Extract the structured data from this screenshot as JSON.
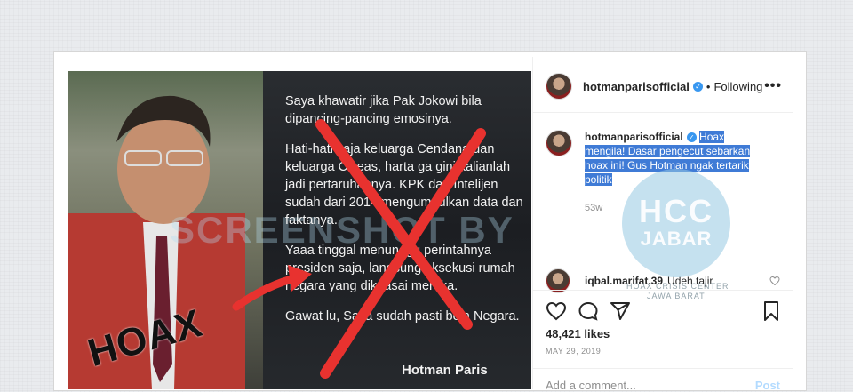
{
  "post": {
    "image_text": {
      "paragraphs": [
        "Saya khawatir jika Pak Jokowi bila dipancing-pancing emosinya.",
        "Hati-hati saja keluarga Cendana dan keluarga Cikeas, harta ga gini kalianlah jadi pertaruhannya. KPK dan Intelijen sudah dari 2014 mengumpulkan data dan faktanya.",
        "Yaaa tinggal menunggu perintahnya presiden saja, langsung eksekusi rumah negara yang dikuasai mereka.",
        "Gawat lu, Saya sudah pasti bela Negara."
      ],
      "signature": "Hotman Paris",
      "stamp": "HOAX",
      "watermark": "SCREENSHOT BY"
    },
    "header": {
      "username": "hotmanparisofficial",
      "separator": "•",
      "following": "Following",
      "more": "•••"
    },
    "caption": {
      "username": "hotmanparisofficial",
      "text": "Hoax mengila! Dasar pengecut sebarkan hoax ini! Gus Hotman ngak tertarik politik",
      "age": "53w"
    },
    "comment": {
      "username": "iqbal.marifat.39",
      "text": "Udeh tajir"
    },
    "likes": "48,421 likes",
    "date": "MAY 29, 2019",
    "add_comment_placeholder": "Add a comment...",
    "post_label": "Post",
    "logo": {
      "main": "HCC",
      "sub": "JABAR",
      "caption_line1": "HOAX CRISIS CENTER",
      "caption_line2": "JAWA BARAT"
    }
  },
  "colors": {
    "accent": "#3897f0",
    "highlight": "#3f7bd6",
    "cross": "#e8322f"
  },
  "icons": [
    "heart-icon",
    "comment-icon",
    "share-icon",
    "bookmark-icon",
    "more-icon",
    "verified-icon",
    "like-comment-icon"
  ]
}
